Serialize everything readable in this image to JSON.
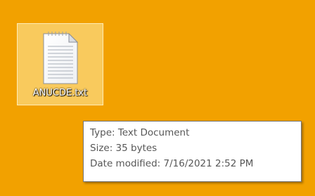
{
  "desktop": {
    "background_color": "#f2a100",
    "icons": [
      {
        "label": "ANUCDE.txt",
        "icon": "text-document-icon",
        "selected": true
      }
    ]
  },
  "tooltip": {
    "type_line": "Type: Text Document",
    "size_line": "Size: 35 bytes",
    "date_line": "Date modified: 7/16/2021 2:52 PM"
  }
}
